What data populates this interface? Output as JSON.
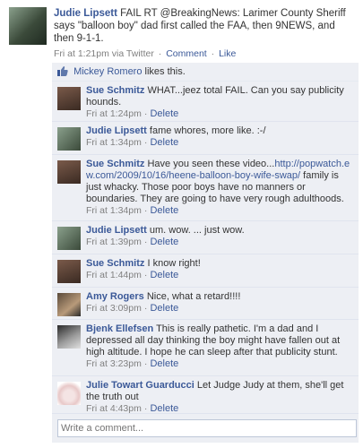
{
  "post": {
    "author": "Judie Lipsett",
    "text": "FAIL RT @BreakingNews: Larimer County Sheriff says \"balloon boy\" dad first called the FAA, then 9NEWS, and then 9-1-1.",
    "time": "Fri at 1:21pm via Twitter",
    "comment_link": "Comment",
    "like_link": "Like",
    "separator": "·"
  },
  "likes": {
    "name": "Mickey Romero",
    "text": "likes this."
  },
  "comments": [
    {
      "author": "Sue Schmitz",
      "text": "WHAT...jeez total FAIL. Can you say publicity hounds.",
      "time": "Fri at 1:24pm",
      "delete": "Delete",
      "avatar_icon": "profile-photo"
    },
    {
      "author": "Judie Lipsett",
      "text": "fame whores, more like. :-/",
      "time": "Fri at 1:34pm",
      "delete": "Delete",
      "avatar_icon": "profile-photo"
    },
    {
      "author": "Sue Schmitz",
      "text_before": "Have you seen these video...",
      "url": "http://popwatch.ew.com/2009/10/16/heene-balloon-boy-wife-swap/",
      "text_after": " family is just whacky. Those poor boys have no manners or boundaries. They are going to have very rough adulthoods.",
      "time": "Fri at 1:34pm",
      "delete": "Delete",
      "avatar_icon": "profile-photo"
    },
    {
      "author": "Judie Lipsett",
      "text": "um. wow. ... just wow.",
      "time": "Fri at 1:39pm",
      "delete": "Delete",
      "avatar_icon": "profile-photo"
    },
    {
      "author": "Sue Schmitz",
      "text": "I know right!",
      "time": "Fri at 1:44pm",
      "delete": "Delete",
      "avatar_icon": "profile-photo"
    },
    {
      "author": "Amy Rogers",
      "text": "Nice, what a retard!!!!",
      "time": "Fri at 3:09pm",
      "delete": "Delete",
      "avatar_icon": "profile-photo"
    },
    {
      "author": "Bjenk Ellefsen",
      "text": "This is really pathetic. I'm a dad and I depressed all day thinking the boy might have fallen out at high altitude. I hope he can sleep after that publicity stunt.",
      "time": "Fri at 3:23pm",
      "delete": "Delete",
      "avatar_icon": "profile-photo"
    },
    {
      "author": "Julie Towart Guarducci",
      "text": "Let Judge Judy at them, she'll get the truth out",
      "time": "Fri at 4:43pm",
      "delete": "Delete",
      "avatar_icon": "profile-photo"
    }
  ],
  "write_comment": {
    "placeholder": "Write a comment..."
  },
  "colors": {
    "link": "#3b5998",
    "feedback_bg": "#edeff4",
    "meta": "#808080"
  }
}
